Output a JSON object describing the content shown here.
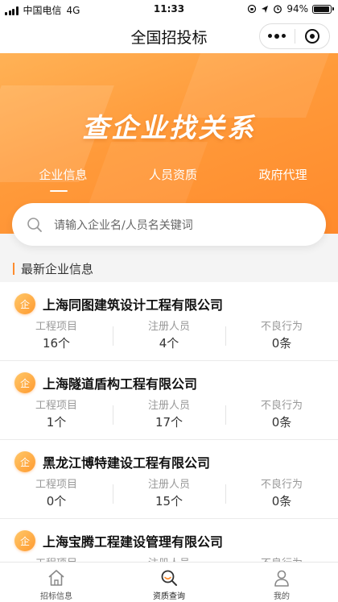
{
  "status_bar": {
    "carrier": "中国电信",
    "network": "4G",
    "time": "11:33",
    "battery": "94%"
  },
  "navbar": {
    "title": "全国招投标"
  },
  "banner": {
    "headline": "查企业找关系",
    "tabs": [
      {
        "label": "企业信息",
        "active": true
      },
      {
        "label": "人员资质",
        "active": false
      },
      {
        "label": "政府代理",
        "active": false
      }
    ]
  },
  "search": {
    "placeholder": "请输入企业名/人员名关键词"
  },
  "section": {
    "title": "最新企业信息"
  },
  "companies": [
    {
      "badge": "企",
      "name": "上海同图建筑设计工程有限公司",
      "stats": [
        {
          "label": "工程项目",
          "value": "16个"
        },
        {
          "label": "注册人员",
          "value": "4个"
        },
        {
          "label": "不良行为",
          "value": "0条"
        }
      ]
    },
    {
      "badge": "企",
      "name": "上海隧道盾构工程有限公司",
      "stats": [
        {
          "label": "工程项目",
          "value": "1个"
        },
        {
          "label": "注册人员",
          "value": "17个"
        },
        {
          "label": "不良行为",
          "value": "0条"
        }
      ]
    },
    {
      "badge": "企",
      "name": "黑龙江博特建设工程有限公司",
      "stats": [
        {
          "label": "工程项目",
          "value": "0个"
        },
        {
          "label": "注册人员",
          "value": "15个"
        },
        {
          "label": "不良行为",
          "value": "0条"
        }
      ]
    },
    {
      "badge": "企",
      "name": "上海宝腾工程建设管理有限公司",
      "stats": [
        {
          "label": "工程项目",
          "value": ""
        },
        {
          "label": "注册人员",
          "value": ""
        },
        {
          "label": "不良行为",
          "value": ""
        }
      ]
    }
  ],
  "tabbar": [
    {
      "label": "招标信息",
      "icon": "home-icon"
    },
    {
      "label": "资质查询",
      "icon": "search-icon"
    },
    {
      "label": "我的",
      "icon": "user-icon"
    }
  ],
  "colors": {
    "accent": "#ff8c2e",
    "banner_start": "#ffb256",
    "banner_end": "#ff8a2c"
  }
}
